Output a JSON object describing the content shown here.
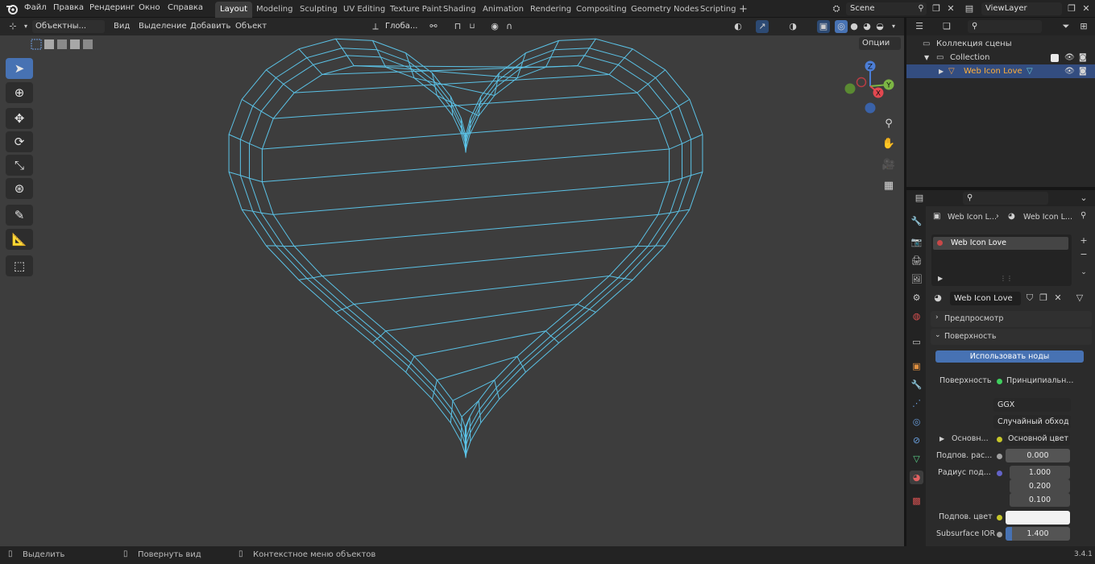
{
  "topbar": {
    "menus": [
      "Файл",
      "Правка",
      "Рендеринг",
      "Окно",
      "Справка"
    ],
    "workspaces": [
      "Layout",
      "Modeling",
      "Sculpting",
      "UV Editing",
      "Texture Paint",
      "Shading",
      "Animation",
      "Rendering",
      "Compositing",
      "Geometry Nodes",
      "Scripting"
    ],
    "active_workspace": "Layout",
    "add_workspace": "+",
    "scene": "Scene",
    "view_layer": "ViewLayer"
  },
  "viewport": {
    "mode": "Объектны...",
    "menus": [
      "Вид",
      "Выделение",
      "Добавить",
      "Объект"
    ],
    "transform_orientation": "Глоба...",
    "options_label": "Опции",
    "gizmo": {
      "z": "Z",
      "y": "Y",
      "x": "X"
    },
    "wire_color": "#5bc2e6",
    "background": "#3d3d3d"
  },
  "tools": [
    "select-box",
    "cursor",
    "move",
    "rotate",
    "scale",
    "transform",
    "annotate",
    "measure",
    "add-cube"
  ],
  "outliner": {
    "scene_collection": "Коллекция сцены",
    "collection": "Collection",
    "object": "Web Icon Love"
  },
  "properties": {
    "breadcrumb_object": "Web Icon L...",
    "breadcrumb_material": "Web Icon L...",
    "material_slot": "Web Icon Love",
    "material_name": "Web Icon Love",
    "panels": {
      "preview": "Предпросмотр",
      "surface": "Поверхность"
    },
    "use_nodes_button": "Использовать ноды",
    "surface_label": "Поверхность",
    "surface_value": "Принципиальн...",
    "distribution": "GGX",
    "subsurface_method": "Случайный обход",
    "base_label": "Основн...",
    "base_value": "Основной цвет",
    "subsurface_weight_label": "Подпов. рас...",
    "subsurface_weight": "0.000",
    "subsurface_radius_label": "Радиус под...",
    "subsurface_radius": [
      "1.000",
      "0.200",
      "0.100"
    ],
    "subsurface_color_label": "Подпов. цвет",
    "subsurface_ior_label": "Subsurface IOR",
    "subsurface_ior": "1.400",
    "subsurface_ior_fill": 0.1
  },
  "statusbar": {
    "select": "Выделить",
    "rotate": "Повернуть вид",
    "context": "Контекстное меню объектов",
    "version": "3.4.1"
  }
}
